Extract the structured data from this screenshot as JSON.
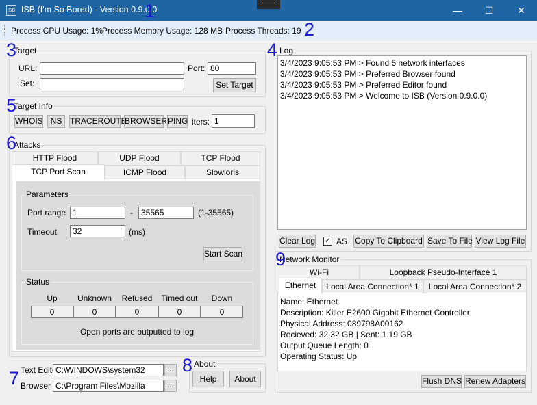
{
  "window": {
    "title": "ISB (I'm So Bored) - Version 0.9.0.0",
    "icon_text": "ISB",
    "min_icon": "—",
    "max_icon": "☐",
    "close_icon": "✕"
  },
  "status": {
    "cpu": "Process CPU Usage: 1%",
    "memory": "Process Memory Usage: 128 MB",
    "threads": "Process Threads: 19"
  },
  "annotations": {
    "n1": "1",
    "n2": "2",
    "n3": "3",
    "n4": "4",
    "n5": "5",
    "n6": "6",
    "n7": "7",
    "n8": "8",
    "n9": "9"
  },
  "target": {
    "group_label": "Target",
    "url_label": "URL:",
    "url_value": "",
    "port_label": "Port:",
    "port_value": "80",
    "set_label": "Set:",
    "set_value": "",
    "set_target_button": "Set Target"
  },
  "target_info": {
    "group_label": "Target Info",
    "buttons": [
      "WHOIS",
      "NS",
      "TRACEROUTE",
      "BROWSER",
      "PING"
    ],
    "iters_label": "iters:",
    "iters_value": "1"
  },
  "attacks": {
    "group_label": "Attacks",
    "tabs_row1": [
      "HTTP Flood",
      "UDP Flood",
      "TCP Flood"
    ],
    "tabs_row2": [
      "TCP Port Scan",
      "ICMP Flood",
      "Slowloris"
    ],
    "active_tab": "TCP Port Scan",
    "parameters": {
      "label": "Parameters",
      "port_range_label": "Port range",
      "port_from": "1",
      "dash": "-",
      "port_to": "35565",
      "range_hint": "(1-35565)",
      "timeout_label": "Timeout",
      "timeout_value": "32",
      "timeout_unit": "(ms)",
      "start_button": "Start Scan"
    },
    "status": {
      "label": "Status",
      "columns": [
        "Up",
        "Unknown",
        "Refused",
        "Timed out",
        "Down"
      ],
      "values": [
        "0",
        "0",
        "0",
        "0",
        "0"
      ],
      "note": "Open ports are outputted to log"
    }
  },
  "log": {
    "group_label": "Log",
    "lines": [
      "3/4/2023 9:05:53 PM > Found 5 network interfaces",
      "3/4/2023 9:05:53 PM > Preferred Browser found",
      "3/4/2023 9:05:53 PM > Preferred Editor found",
      "3/4/2023 9:05:53 PM > Welcome to ISB (Version 0.9.0.0)"
    ],
    "clear_button": "Clear Log",
    "as_label": "AS",
    "as_checked": true,
    "copy_button": "Copy To Clipboard",
    "save_button": "Save To File",
    "view_button": "View Log File"
  },
  "paths": {
    "editor_label": "Text Editor",
    "editor_value": "C:\\WINDOWS\\system32",
    "browser_label": "Browser",
    "browser_value": "C:\\Program Files\\Mozilla",
    "browse_button": "..."
  },
  "about": {
    "group_label": "About",
    "help_button": "Help",
    "about_button": "About"
  },
  "network": {
    "group_label": "Network Monitor",
    "tabs_row1": [
      "Wi-Fi",
      "Loopback Pseudo-Interface 1"
    ],
    "tabs_row2": [
      "Ethernet",
      "Local Area Connection* 1",
      "Local Area Connection* 2"
    ],
    "active_tab": "Ethernet",
    "details": [
      "Name: Ethernet",
      "Description: Killer E2600 Gigabit Ethernet Controller",
      "Physical Address: 089798A00162",
      "Recieved: 32.32 GB | Sent: 1.19 GB",
      "Output Queue Length: 0",
      "Operating Status: Up"
    ],
    "flush_button": "Flush DNS",
    "renew_button": "Renew Adapters"
  }
}
